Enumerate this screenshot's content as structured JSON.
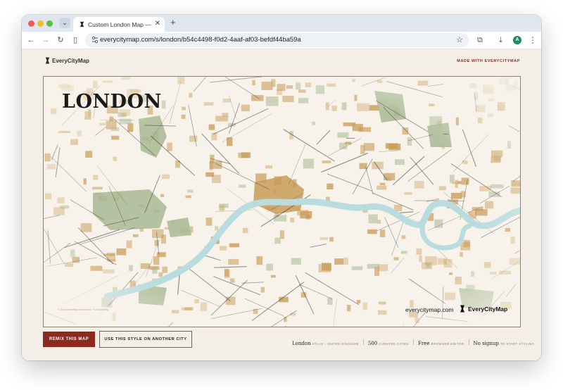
{
  "browser": {
    "tab_title": "Custom London Map — Atlas",
    "tab_close": "✕",
    "new_tab": "+",
    "url": "everycitymap.com/s/london/b54c4498-f0d2-4aaf-af03-befdf44ba59a",
    "avatar_letter": "A",
    "icons": [
      "back-arrow-icon",
      "forward-arrow-icon",
      "reload-icon",
      "side-panel-icon",
      "site-settings-icon",
      "bookmark-star-icon",
      "extensions-icon",
      "download-icon",
      "more-icon"
    ]
  },
  "header": {
    "brand": "EveryCityMap",
    "made_with": "MADE WITH EVERYCITYMAP"
  },
  "map": {
    "city": "LONDON",
    "url_caption": "everycitymap.com",
    "logo_text": "EveryCityMap",
    "attribution": "© OpenStreetMap contributors · EveryCityMap",
    "colors": {
      "background": "#f7f3ea",
      "river": "#b9dcdf",
      "parks": "#a9b894",
      "blocks": "#c89b58",
      "roads": "#3a3a3a"
    }
  },
  "actions": {
    "remix": "REMIX THIS MAP",
    "style_other_city": "USE THIS STYLE ON ANOTHER CITY"
  },
  "stats": [
    {
      "value": "London",
      "label": "ATLAS · UNITED KINGDOM"
    },
    {
      "value": "500",
      "label": "CURATED CITIES"
    },
    {
      "value": "Free",
      "label": "BROWSER EDITOR"
    },
    {
      "value": "No signup",
      "label": "TO START STYLING"
    }
  ]
}
